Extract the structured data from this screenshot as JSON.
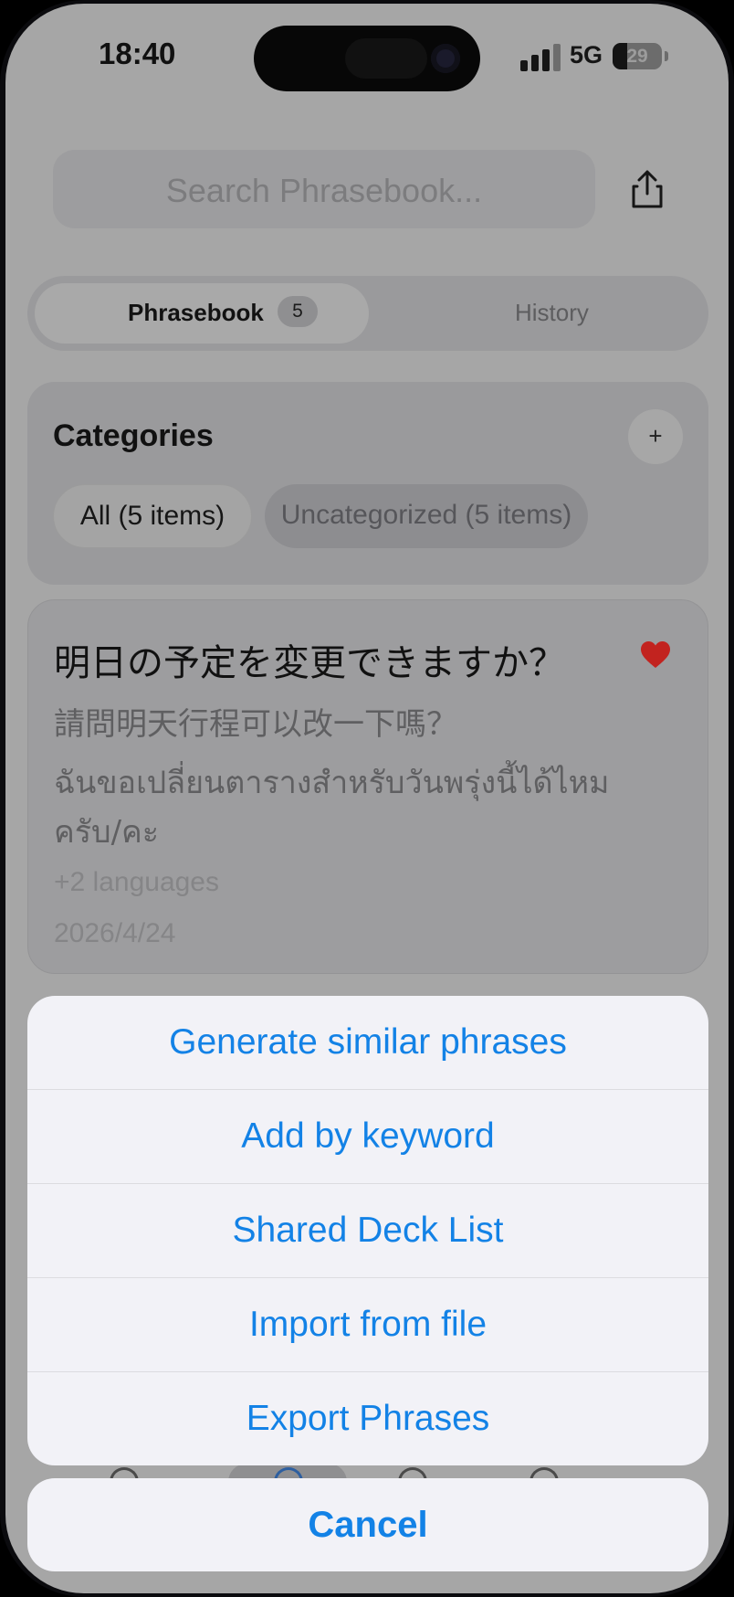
{
  "status_bar": {
    "time": "18:40",
    "network": "5G",
    "battery": "29",
    "battery_level": 0.29
  },
  "search": {
    "placeholder": "Search Phrasebook..."
  },
  "segmented": {
    "tab1": "Phrasebook",
    "tab1_badge": "5",
    "tab2": "History"
  },
  "categories": {
    "title": "Categories",
    "add": "+",
    "chips": [
      "All (5 items)",
      "Uncategorized (5 items)"
    ]
  },
  "phrase": {
    "main": "明日の予定を変更できますか？",
    "chinese": "請問明天行程可以改一下嗎？",
    "thai_line1": "ฉันขอเปลี่ยนตารางสำหรับวันพรุ่งนี้ได้ไหม",
    "thai_line2": "ครับ/คะ",
    "more_languages": "+2 languages",
    "date": "2026/4/24",
    "favorite_icon": "heart-icon",
    "favorite_color": "#c2231f"
  },
  "action_sheet": {
    "items": [
      "Generate similar phrases",
      "Add by keyword",
      "Shared Deck List",
      "Import from file",
      "Export Phrases"
    ],
    "cancel": "Cancel",
    "accent": "#1382e6"
  }
}
